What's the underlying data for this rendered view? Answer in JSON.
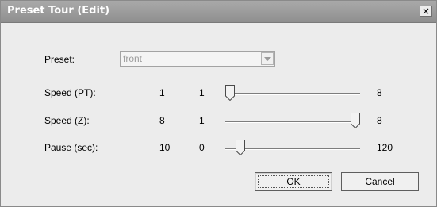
{
  "window": {
    "title": "Preset Tour (Edit)",
    "close_glyph": "×"
  },
  "preset": {
    "label": "Preset:",
    "value": "front"
  },
  "rows": [
    {
      "label": "Speed (PT):",
      "current": "1",
      "min": "1",
      "max": "8",
      "level": 0.0
    },
    {
      "label": "Speed (Z):",
      "current": "8",
      "min": "1",
      "max": "8",
      "level": 1.0
    },
    {
      "label": "Pause (sec):",
      "current": "10",
      "min": "0",
      "max": "120",
      "level": 0.0833
    }
  ],
  "buttons": {
    "ok": "OK",
    "cancel": "Cancel"
  },
  "icons": {
    "close": "close-icon",
    "dropdown": "chevron-down-icon",
    "thumb": "slider-thumb"
  }
}
